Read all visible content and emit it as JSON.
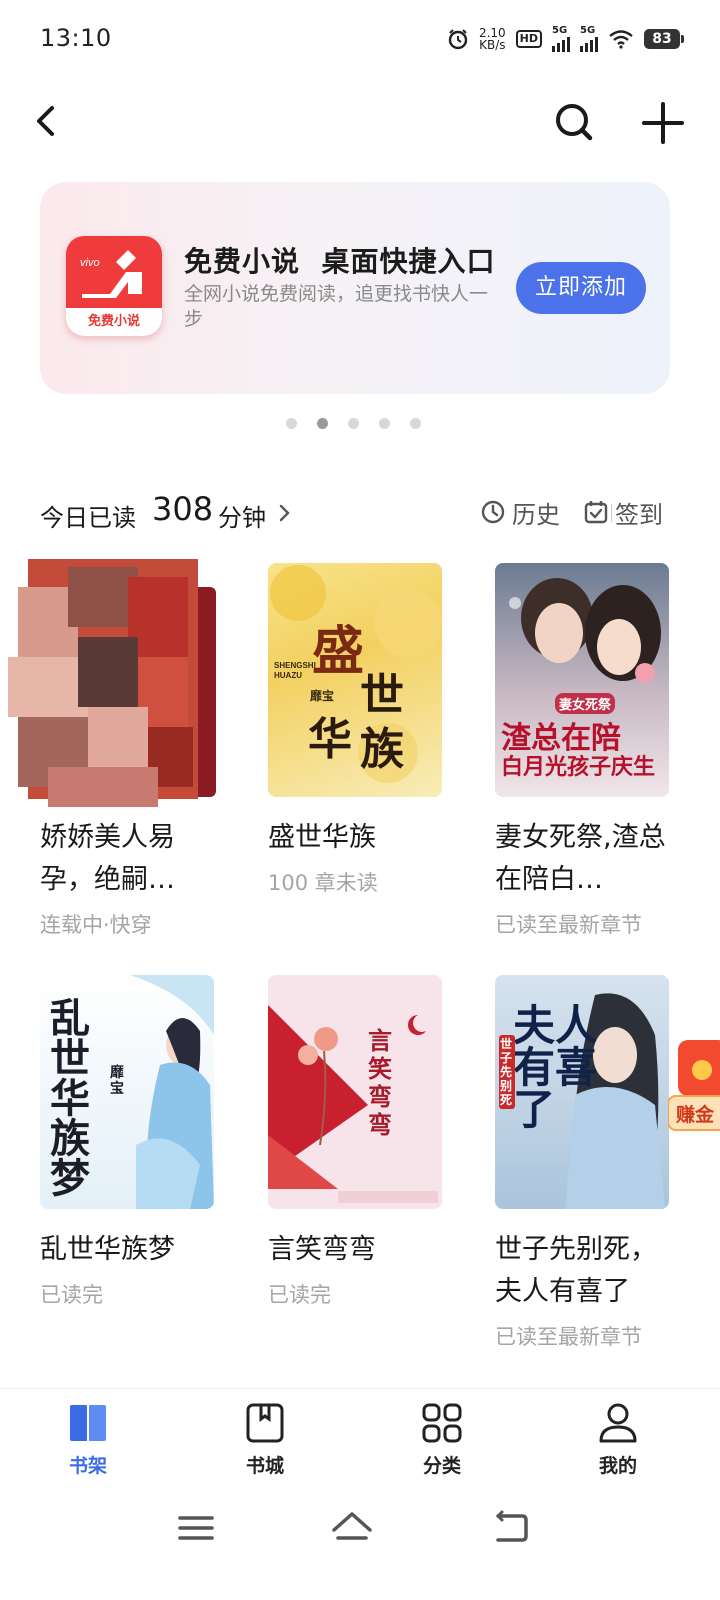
{
  "status_bar": {
    "time": "13:10",
    "net_speed_value": "2.10",
    "net_speed_unit": "KB/s",
    "hd_label": "HD",
    "sim1_label": "5G",
    "sim2_label": "5G",
    "battery": "83"
  },
  "topnav": {
    "back_icon": "back-arrow-icon",
    "search_icon": "search-icon",
    "add_icon": "plus-icon"
  },
  "banner": {
    "app_logo_brand": "vivo",
    "app_logo_name": "免费小说",
    "title": "免费小说  桌面快捷入口",
    "description": "全网小说免费阅读，追更找书快人一步",
    "button_label": "立即添加",
    "accent_color": "#4b72ea"
  },
  "carousel": {
    "dot_count": 5,
    "active_index": 1
  },
  "reading": {
    "prefix": "今日已读",
    "minutes": "308",
    "suffix": "分钟",
    "history_label": "历史",
    "checkin_label": "签到"
  },
  "books": [
    {
      "title": "娇娇美人易孕，绝嗣…",
      "status": "连载中·快穿"
    },
    {
      "title": "盛世华族",
      "status": "100 章未读",
      "cover_text": "盛世华族",
      "cover_pinyin": "SHENGSHI HUAZU",
      "cover_author": "靡宝"
    },
    {
      "title": "妻女死祭,渣总在陪白…",
      "status": "已读至最新章节",
      "cover_text_top": "妻女死祭",
      "cover_text_main": "渣总在陪",
      "cover_text_sub": "白月光孩子庆生"
    },
    {
      "title": "乱世华族梦",
      "status": "已读完",
      "cover_text": "乱世华族梦",
      "cover_author": "靡宝"
    },
    {
      "title": "言笑弯弯",
      "status": "已读完",
      "cover_text": "言笑弯弯"
    },
    {
      "title": "世子先别死，夫人有喜了",
      "status": "已读至最新章节",
      "cover_text": "夫人有喜了",
      "cover_side": "世子先别死"
    }
  ],
  "floating_badge": {
    "label": "赚金"
  },
  "tabbar": {
    "tabs": [
      {
        "label": "书架",
        "icon": "bookshelf-icon",
        "active": true
      },
      {
        "label": "书城",
        "icon": "bookstore-icon",
        "active": false
      },
      {
        "label": "分类",
        "icon": "category-grid-icon",
        "active": false
      },
      {
        "label": "我的",
        "icon": "profile-icon",
        "active": false
      }
    ],
    "active_color": "#3b6ce6"
  },
  "system_nav": {
    "menu_icon": "menu-icon",
    "home_icon": "home-icon",
    "back_icon": "system-back-icon"
  }
}
